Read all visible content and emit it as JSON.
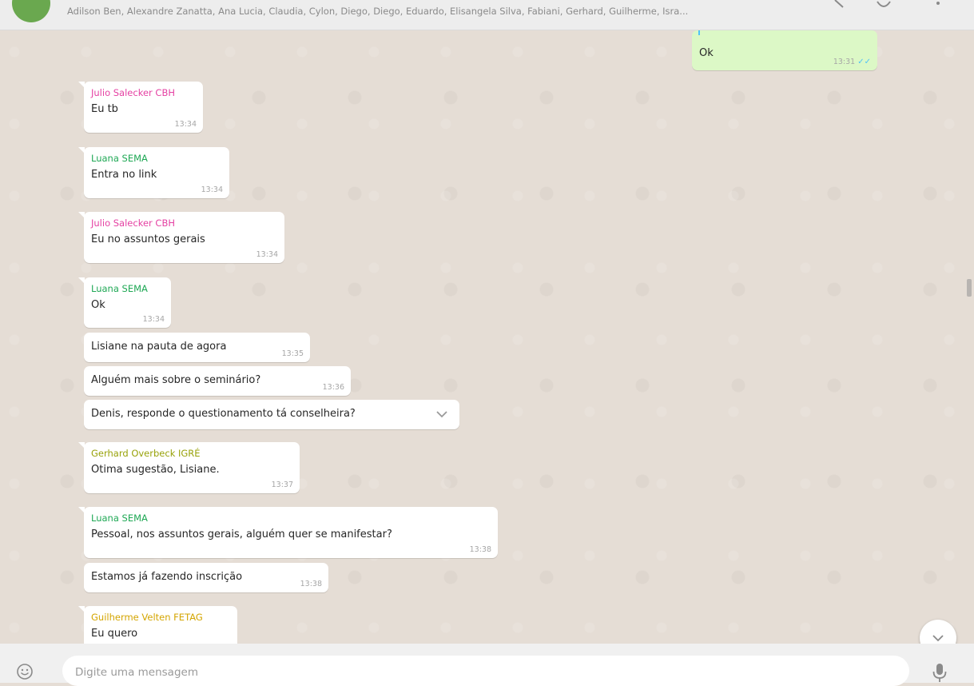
{
  "header": {
    "participants": "Adilson Ben, Alexandre Zanatta, Ana Lucia, Claudia, Cylon, Diego, Diego, Eduardo, Elisangela Silva, Fabiani, Gerhard, Guilherme, Isra..."
  },
  "colors": {
    "outgoing_bubble": "#dcf8c6",
    "incoming_bubble": "#ffffff",
    "chat_background": "#e5ddd5",
    "read_ticks": "#4fc3f7",
    "sender_julio": "#e542a3",
    "sender_luana": "#1fa855",
    "sender_gerhard": "#98a20a",
    "sender_guilherme": "#d4a500"
  },
  "messages": [
    {
      "direction": "out",
      "sender": "",
      "text": "Ok",
      "time": "13:31",
      "status": "read"
    },
    {
      "direction": "in",
      "sender": "Julio Salecker CBH",
      "text": "Eu tb",
      "time": "13:34"
    },
    {
      "direction": "in",
      "sender": "Luana SEMA",
      "text": "Entra no link",
      "time": "13:34"
    },
    {
      "direction": "in",
      "sender": "Julio Salecker CBH",
      "text": "Eu no assuntos gerais",
      "time": "13:34"
    },
    {
      "direction": "in",
      "sender": "Luana SEMA",
      "text": "Ok",
      "time": "13:34"
    },
    {
      "direction": "in",
      "sender": "",
      "text": "Lisiane na pauta de agora",
      "time": "13:35"
    },
    {
      "direction": "in",
      "sender": "",
      "text": "Alguém mais sobre o seminário?",
      "time": "13:36"
    },
    {
      "direction": "in",
      "sender": "",
      "text": "Denis, responde o questionamento tá conselheira?",
      "time": ""
    },
    {
      "direction": "in",
      "sender": "Gerhard Overbeck IGRÉ",
      "text": "Otima sugestão, Lisiane.",
      "time": "13:37"
    },
    {
      "direction": "in",
      "sender": "Luana SEMA",
      "text": "Pessoal, nos assuntos gerais, alguém quer se manifestar?",
      "time": "13:38"
    },
    {
      "direction": "in",
      "sender": "",
      "text": "Estamos já fazendo inscrição",
      "time": "13:38"
    },
    {
      "direction": "in",
      "sender": "Guilherme Velten FETAG",
      "text": "Eu quero",
      "time": ""
    }
  ],
  "composer": {
    "placeholder": "Digite uma mensagem"
  },
  "icons": {
    "emoji": "smiley-icon",
    "mic": "microphone-icon",
    "scroll_down": "chevron-down-icon",
    "search": "search-icon",
    "attach": "paperclip-icon",
    "menu": "menu-dots-icon"
  }
}
